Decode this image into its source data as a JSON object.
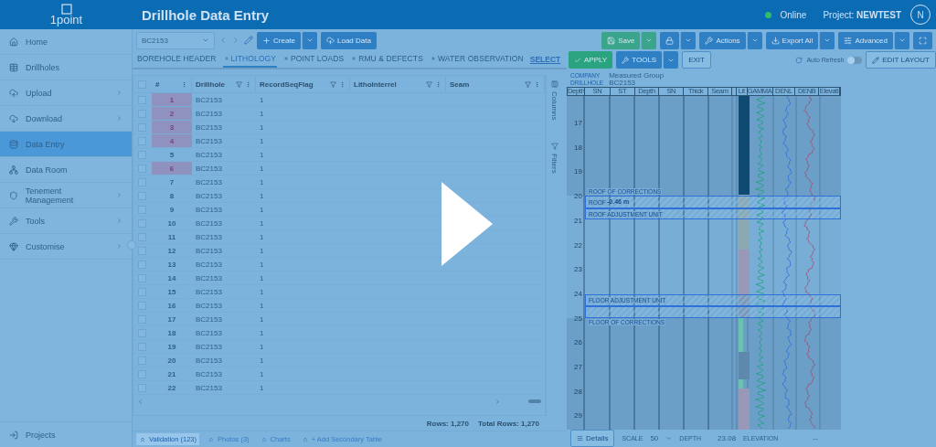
{
  "header": {
    "logo": "1point",
    "title": "Drillhole Data Entry",
    "status": "Online",
    "project": "Project: **NEWTEST**",
    "avatar": "N"
  },
  "sidebar": {
    "items": [
      {
        "label": "Home",
        "submenu": false,
        "selected": false
      },
      {
        "label": "Drillholes",
        "submenu": false,
        "selected": false
      },
      {
        "label": "Upload",
        "submenu": true,
        "selected": false
      },
      {
        "label": "Download",
        "submenu": true,
        "selected": false
      },
      {
        "label": "Data Entry",
        "submenu": false,
        "selected": true
      },
      {
        "label": "Data Room",
        "submenu": false,
        "selected": false
      },
      {
        "label": "Tenement Management",
        "submenu": true,
        "selected": false
      },
      {
        "label": "Tools",
        "submenu": true,
        "selected": false
      },
      {
        "label": "Customise",
        "submenu": true,
        "selected": false
      }
    ],
    "footer_item": "Projects"
  },
  "toolbar": {
    "drillhole": "BC2153",
    "create": "Create",
    "load_data": "Load Data",
    "save": "Save",
    "actions": "Actions",
    "export": "Export All",
    "advanced": "Advanced"
  },
  "tabs": [
    {
      "label": "BOREHOLE HEADER",
      "marked": false,
      "selected": false
    },
    {
      "label": "LITHOLOGY",
      "marked": true,
      "selected": true
    },
    {
      "label": "POINT LOADS",
      "marked": true,
      "selected": false
    },
    {
      "label": "RMU & DEFECTS",
      "marked": true,
      "selected": false
    },
    {
      "label": "WATER OBSERVATION",
      "marked": true,
      "selected": false
    }
  ],
  "select_link": "SELECT",
  "table": {
    "all_checked": false,
    "columns": [
      "#",
      "Drillhole",
      "RecordSeqFlag",
      "LithoInterrel",
      "Seam"
    ],
    "rows": [
      {
        "checked": false,
        "number": "1",
        "drillhole": "BC2153",
        "flag": "1",
        "highlighted": true
      },
      {
        "checked": false,
        "number": "2",
        "drillhole": "BC2153",
        "flag": "1",
        "highlighted": true
      },
      {
        "checked": false,
        "number": "3",
        "drillhole": "BC2153",
        "flag": "1",
        "highlighted": true
      },
      {
        "checked": false,
        "number": "4",
        "drillhole": "BC2153",
        "flag": "1",
        "highlighted": true
      },
      {
        "checked": false,
        "number": "5",
        "drillhole": "BC2153",
        "flag": "1",
        "highlighted": false
      },
      {
        "checked": false,
        "number": "6",
        "drillhole": "BC2153",
        "flag": "1",
        "highlighted": true
      },
      {
        "checked": false,
        "number": "7",
        "drillhole": "BC2153",
        "flag": "1",
        "highlighted": false
      },
      {
        "checked": false,
        "number": "8",
        "drillhole": "BC2153",
        "flag": "1",
        "highlighted": false
      },
      {
        "checked": false,
        "number": "9",
        "drillhole": "BC2153",
        "flag": "1",
        "highlighted": false
      },
      {
        "checked": false,
        "number": "10",
        "drillhole": "BC2153",
        "flag": "1",
        "highlighted": false
      },
      {
        "checked": false,
        "number": "11",
        "drillhole": "BC2153",
        "flag": "1",
        "highlighted": false
      },
      {
        "checked": false,
        "number": "12",
        "drillhole": "BC2153",
        "flag": "1",
        "highlighted": false
      },
      {
        "checked": false,
        "number": "13",
        "drillhole": "BC2153",
        "flag": "1",
        "highlighted": false
      },
      {
        "checked": false,
        "number": "14",
        "drillhole": "BC2153",
        "flag": "1",
        "highlighted": false
      },
      {
        "checked": false,
        "number": "15",
        "drillhole": "BC2153",
        "flag": "1",
        "highlighted": false
      },
      {
        "checked": false,
        "number": "16",
        "drillhole": "BC2153",
        "flag": "1",
        "highlighted": false
      },
      {
        "checked": false,
        "number": "17",
        "drillhole": "BC2153",
        "flag": "1",
        "highlighted": false
      },
      {
        "checked": false,
        "number": "18",
        "drillhole": "BC2153",
        "flag": "1",
        "highlighted": false
      },
      {
        "checked": false,
        "number": "19",
        "drillhole": "BC2153",
        "flag": "1",
        "highlighted": false
      },
      {
        "checked": false,
        "number": "20",
        "drillhole": "BC2153",
        "flag": "1",
        "highlighted": false
      },
      {
        "checked": false,
        "number": "21",
        "drillhole": "BC2153",
        "flag": "1",
        "highlighted": false
      },
      {
        "checked": false,
        "number": "22",
        "drillhole": "BC2153",
        "flag": "1",
        "highlighted": false
      }
    ]
  },
  "side_tabs": [
    "Columns",
    "Filters"
  ],
  "rows_count": "Rows: 1,270",
  "total_rows": "Total Rows: 1,270",
  "bottom_tabs": [
    {
      "label": "Validation (123)",
      "selected": true
    },
    {
      "label": "Photos (3)",
      "selected": false
    },
    {
      "label": "Charts",
      "selected": false
    },
    {
      "label": "+ Add Secondary Table",
      "selected": false
    }
  ],
  "log": {
    "apply": "APPLY",
    "tools": "TOOLS",
    "exit": "EXIT",
    "auto_refresh": {
      "label": "Auto Refresh",
      "on": false
    },
    "edit_layout": "EDIT LAYOUT",
    "company_label": "COMPANY",
    "company": "Measured Group",
    "drillhole_label": "DRILLHOLE",
    "drillhole": "BC2153",
    "columns": [
      "Depth",
      "SN",
      "ST",
      "Depth",
      "SN",
      "Thick",
      "Seam",
      "",
      "Lit",
      "GAMMA",
      "DENL",
      "DENB",
      "Elevati"
    ],
    "depth_ticks": [
      "17",
      "18",
      "19",
      "20",
      "21",
      "22",
      "23",
      "24",
      "25",
      "26",
      "27",
      "28",
      "29"
    ],
    "annotations": [
      "ROOF OF CORRECTIONS",
      "ROOF",
      "ROOF ADJUSTMENT UNIT",
      "FLOOR ADJUSTMENT UNIT",
      "FLOOR OF CORRECTIONS"
    ],
    "roof_value": "-0.46 m",
    "footer": {
      "details": "Details",
      "scale_label": "SCALE",
      "scale": "50",
      "depth_label": "DEPTH",
      "depth": "23.08",
      "elevation_label": "ELEVATION",
      "elevation": "--"
    }
  }
}
